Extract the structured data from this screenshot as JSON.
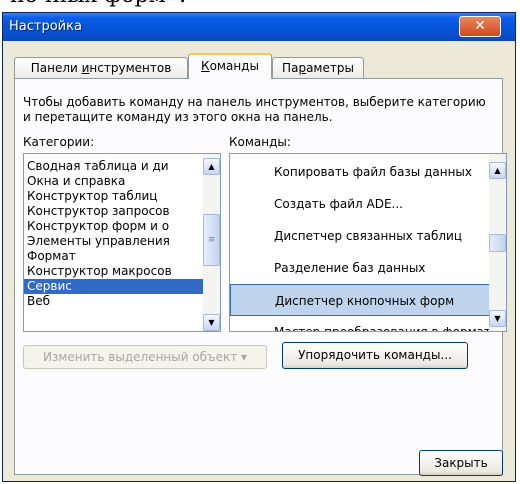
{
  "background_text": "ночных форм».",
  "window": {
    "title": "Настройка",
    "close_glyph": "✕"
  },
  "tabs": [
    {
      "label": "Панели инструментов",
      "underline_index": 7
    },
    {
      "label": "Команды",
      "underline_index": 0
    },
    {
      "label": "Параметры",
      "underline_index": 2
    }
  ],
  "active_tab": "Команды",
  "instruction": "Чтобы добавить команду на панель инструментов, выберите категорию и перетащите команду из этого окна на панель.",
  "categories": {
    "label": "Категории:",
    "items": [
      "Сводная таблица и ди",
      "Окна и справка",
      "Конструктор таблиц",
      "Конструктор запросов",
      "Конструктор форм и о",
      "Элементы управления",
      "Формат",
      "Конструктор макросов",
      "Сервис",
      "Веб"
    ],
    "selected": "Сервис"
  },
  "commands": {
    "label": "Команды:",
    "items": [
      "Копировать файл базы данных",
      "Создать файл ADE...",
      "Диспетчер связанных таблиц",
      "Разделение баз данных",
      "Диспетчер кнопочных форм",
      "Мастер преобразования в формат"
    ],
    "selected": "Диспетчер кнопочных форм"
  },
  "buttons": {
    "modify_selection": "Изменить выделенный объект ▾",
    "rearrange": "Упорядочить команды...",
    "close": "Закрыть"
  },
  "colors": {
    "selection_blue": "#316ac5",
    "title_blue": "#0553d8",
    "close_red": "#d24a1d",
    "tab_highlight": "#ffc83c"
  }
}
